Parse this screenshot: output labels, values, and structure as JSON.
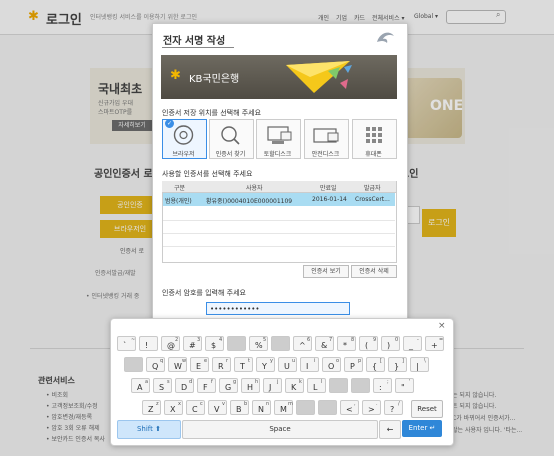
{
  "header": {
    "logo_star": "✱",
    "logo_text": "로그인",
    "description": "인터넷뱅킹 서비스를 이용하기 위한 로그인",
    "links": [
      "개인",
      "기업",
      "카드",
      "전체서비스 ▾"
    ],
    "global": "Global ▾",
    "search_icon": "⌕"
  },
  "banner": {
    "title": "국내최초",
    "sub1": "신규가입 우대",
    "sub2": "스마트OTP를",
    "button": "자세히보기",
    "card_text": "ONE"
  },
  "main": {
    "left_title": "공인인증서 로",
    "right_title": "그인",
    "left_buttons": [
      "공인인증",
      "브라우저인"
    ],
    "cert_label": "인증서 로",
    "mgmt_label": "인증서발급/재발",
    "bullet": "• 인터넷뱅킹 거래 중",
    "login_button": "로그인"
  },
  "services": {
    "title": "관련서비스",
    "items": [
      "• 비조회",
      "• 고객정보조회/수정",
      "• 암호변경/재등록",
      "• 암호 3회 오류 해제",
      "• 보안카드 인증서 복사"
    ],
    "right_notes": [
      "는 되지 않습니다.",
      "트 되지 않습니다.",
      "C가 바뀌어서 인증서가...",
      "않는 사용자 입니다. '타는..."
    ]
  },
  "dialog": {
    "title": "전자 서명 작성",
    "bank_star": "✱",
    "bank_name": "KB국민은행",
    "storage_prompt": "인증서 저장 위치를 선택해 주세요",
    "storage_options": [
      {
        "label": "브라우저",
        "icon": "browser-icon",
        "selected": true
      },
      {
        "label": "인증서 찾기",
        "icon": "search-icon",
        "selected": false
      },
      {
        "label": "토할디스크",
        "icon": "hard-disk-icon",
        "selected": false
      },
      {
        "label": "안전디스크",
        "icon": "secure-disk-icon",
        "selected": false
      },
      {
        "label": "휴대폰",
        "icon": "keypad-icon",
        "selected": false
      }
    ],
    "check_mark": "✓",
    "cert_prompt": "사용할 인증서를 선택해 주세요",
    "table_headers": [
      "구분",
      "사용자",
      "만료일",
      "발급자"
    ],
    "table_rows": [
      {
        "type": "범용(개인)",
        "user": "황유중()0004010E000001109",
        "expiry": "2016-01-14",
        "issuer": "CrossCert..."
      }
    ],
    "view_button": "인증서 보기",
    "delete_button": "인증서 삭제",
    "password_prompt": "인증서 암호를 입력해 주세요",
    "password_value": "••••••••••••"
  },
  "keyboard": {
    "close": "×",
    "rows": [
      [
        {
          "m": "`",
          "s": "~"
        },
        {
          "m": "!",
          "s": ""
        },
        {
          "m": "@",
          "s": "2"
        },
        {
          "m": "#",
          "s": "3"
        },
        {
          "m": "$",
          "s": "4"
        },
        {
          "m": "",
          "s": "",
          "blank": true
        },
        {
          "m": "%",
          "s": "5"
        },
        {
          "m": "",
          "s": "",
          "blank": true
        },
        {
          "m": "^",
          "s": "6"
        },
        {
          "m": "&",
          "s": "7"
        },
        {
          "m": "*",
          "s": "8"
        },
        {
          "m": "(",
          "s": "9"
        },
        {
          "m": ")",
          "s": "0"
        },
        {
          "m": "_",
          "s": "-"
        },
        {
          "m": "+",
          "s": "="
        }
      ],
      [
        {
          "m": "",
          "s": "",
          "blank": true
        },
        {
          "m": "Q",
          "s": "q"
        },
        {
          "m": "W",
          "s": "w"
        },
        {
          "m": "E",
          "s": "e"
        },
        {
          "m": "R",
          "s": "r"
        },
        {
          "m": "T",
          "s": "t"
        },
        {
          "m": "Y",
          "s": "y"
        },
        {
          "m": "U",
          "s": "u"
        },
        {
          "m": "I",
          "s": "i"
        },
        {
          "m": "O",
          "s": "o"
        },
        {
          "m": "P",
          "s": "p"
        },
        {
          "m": "{",
          "s": "["
        },
        {
          "m": "}",
          "s": "]"
        },
        {
          "m": "|",
          "s": "\\"
        }
      ],
      [
        {
          "m": "A",
          "s": "a"
        },
        {
          "m": "S",
          "s": "s"
        },
        {
          "m": "D",
          "s": "d"
        },
        {
          "m": "F",
          "s": "f"
        },
        {
          "m": "G",
          "s": "g"
        },
        {
          "m": "H",
          "s": "h"
        },
        {
          "m": "J",
          "s": "j"
        },
        {
          "m": "K",
          "s": "k"
        },
        {
          "m": "L",
          "s": "l"
        },
        {
          "m": "",
          "s": "",
          "blank": true
        },
        {
          "m": "",
          "s": "",
          "blank": true
        },
        {
          "m": ":",
          "s": ";"
        },
        {
          "m": "\"",
          "s": "'"
        }
      ],
      [
        {
          "m": "Z",
          "s": "z"
        },
        {
          "m": "X",
          "s": "x"
        },
        {
          "m": "C",
          "s": "c"
        },
        {
          "m": "V",
          "s": "v"
        },
        {
          "m": "B",
          "s": "b"
        },
        {
          "m": "N",
          "s": "n"
        },
        {
          "m": "M",
          "s": "m"
        },
        {
          "m": "",
          "s": "",
          "blank": true
        },
        {
          "m": "",
          "s": "",
          "blank": true
        },
        {
          "m": "<",
          "s": ","
        },
        {
          "m": ">",
          "s": "."
        },
        {
          "m": "?",
          "s": "/"
        }
      ]
    ],
    "reset": "Reset",
    "shift": "Shift ⬆",
    "space": "Space",
    "backspace": "←",
    "enter": "Enter ↵"
  }
}
